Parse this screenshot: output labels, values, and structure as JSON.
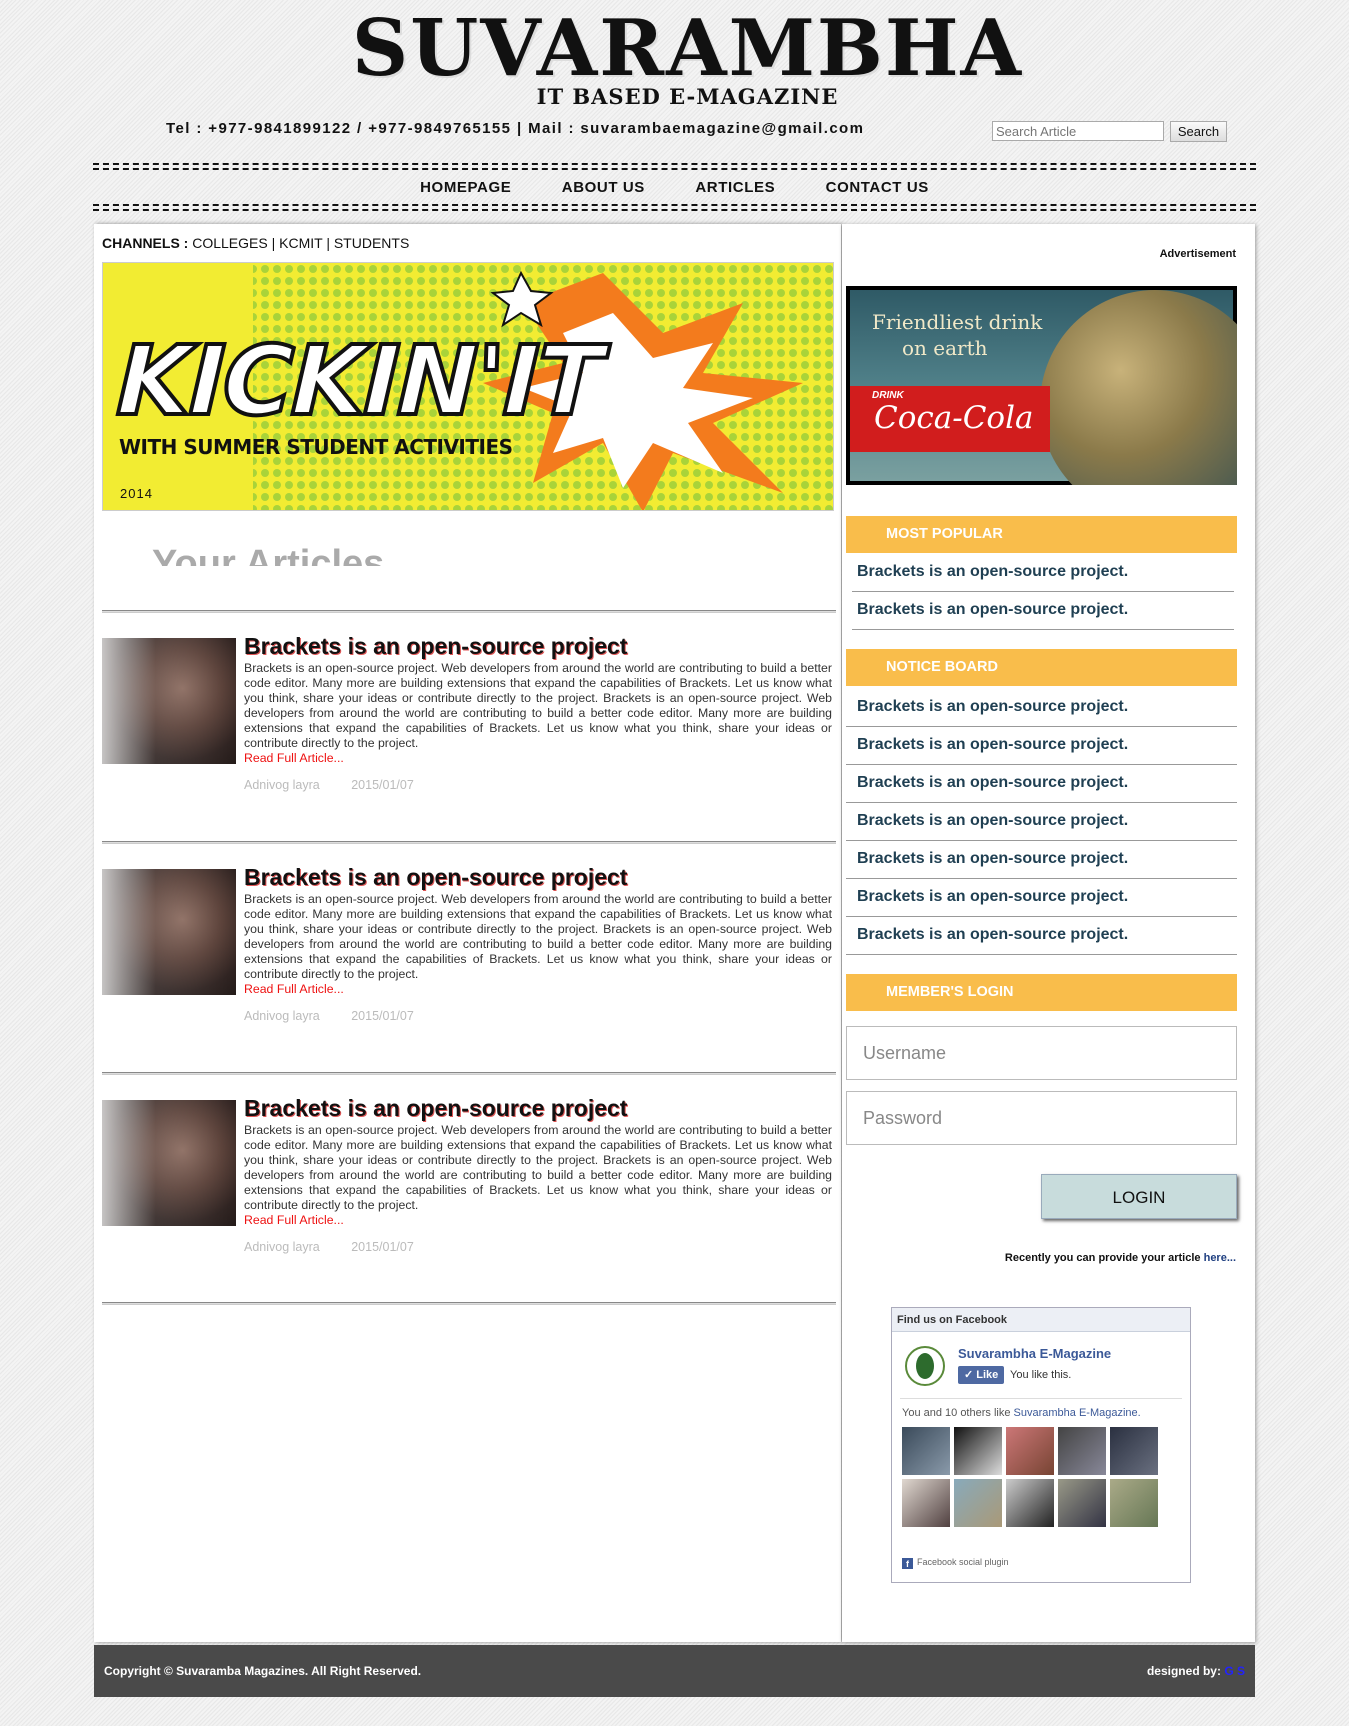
{
  "header": {
    "logo_title": "SUVARAMBHA",
    "logo_subtitle": "IT BASED E-MAGAZINE",
    "contact": "Tel : +977-9841899122 / +977-9849765155 | Mail : suvarambaemagazine@gmail.com",
    "search_placeholder": "Search Article",
    "search_label": "Search"
  },
  "nav": {
    "items": [
      "HOMEPAGE",
      "ABOUT US",
      "ARTICLES",
      "CONTACT US"
    ]
  },
  "channels": {
    "label": "CHANNELS :",
    "items": "COLLEGES | KCMIT | STUDENTS"
  },
  "banner": {
    "title": "KICKIN'IT",
    "subtitle": "WITH SUMMER STUDENT ACTIVITIES",
    "year": "2014"
  },
  "main": {
    "heading": "Your Articles",
    "articles": [
      {
        "title": "Brackets is an open-source project",
        "body": "Brackets is an open-source project. Web developers from around the world are contributing to build a better code editor. Many more are building extensions that expand the capabilities of Brackets. Let us know what you think, share your ideas or contribute directly to the project. Brackets is an open-source project. Web developers from around the world are contributing to build a better code editor. Many more are building extensions that expand the capabilities of Brackets. Let us know what you think, share your ideas or contribute directly to the project.",
        "read_more": "Read Full Article...",
        "author": "Adnivog layra",
        "date": "2015/01/07"
      },
      {
        "title": "Brackets is an open-source project",
        "body": "Brackets is an open-source project. Web developers from around the world are contributing to build a better code editor. Many more are building extensions that expand the capabilities of Brackets. Let us know what you think, share your ideas or contribute directly to the project. Brackets is an open-source project. Web developers from around the world are contributing to build a better code editor. Many more are building extensions that expand the capabilities of Brackets. Let us know what you think, share your ideas or contribute directly to the project.",
        "read_more": "Read Full Article...",
        "author": "Adnivog layra",
        "date": "2015/01/07"
      },
      {
        "title": "Brackets is an open-source project",
        "body": "Brackets is an open-source project. Web developers from around the world are contributing to build a better code editor. Many more are building extensions that expand the capabilities of Brackets. Let us know what you think, share your ideas or contribute directly to the project. Brackets is an open-source project. Web developers from around the world are contributing to build a better code editor. Many more are building extensions that expand the capabilities of Brackets. Let us know what you think, share your ideas or contribute directly to the project.",
        "read_more": "Read Full Article...",
        "author": "Adnivog layra",
        "date": "2015/01/07"
      }
    ]
  },
  "sidebar": {
    "ad_label": "Advertisement",
    "ad": {
      "line1": "Friendliest drink",
      "line2": "on earth",
      "drink": "DRINK",
      "brand": "Coca-Cola"
    },
    "most_popular": {
      "title": "MOST POPULAR",
      "items": [
        "Brackets is an open-source project.",
        "Brackets is an open-source project."
      ]
    },
    "notice_board": {
      "title": "NOTICE BOARD",
      "items": [
        "Brackets is an open-source project.",
        "Brackets is an open-source project.",
        "Brackets is an open-source project.",
        "Brackets is an open-source project.",
        "Brackets is an open-source project.",
        "Brackets is an open-source project.",
        "Brackets is an open-source project."
      ]
    },
    "login": {
      "title": "MEMBER'S LOGIN",
      "username_placeholder": "Username",
      "password_placeholder": "Password",
      "button": "LOGIN"
    },
    "recently_text": "Recently you can provide your article",
    "recently_link": "here...",
    "facebook": {
      "header": "Find us on Facebook",
      "page_name": "Suvarambha E-Magazine",
      "like_label": "Like",
      "you_like": "You like this.",
      "others_prefix": "You and 10 others like",
      "others_page": "Suvarambha E-Magazine.",
      "plugin_label": "Facebook social plugin"
    }
  },
  "footer": {
    "copyright": "Copyright © Suvaramba Magazines. All Right Reserved.",
    "designed_by": "designed by:",
    "designer": "G S"
  }
}
